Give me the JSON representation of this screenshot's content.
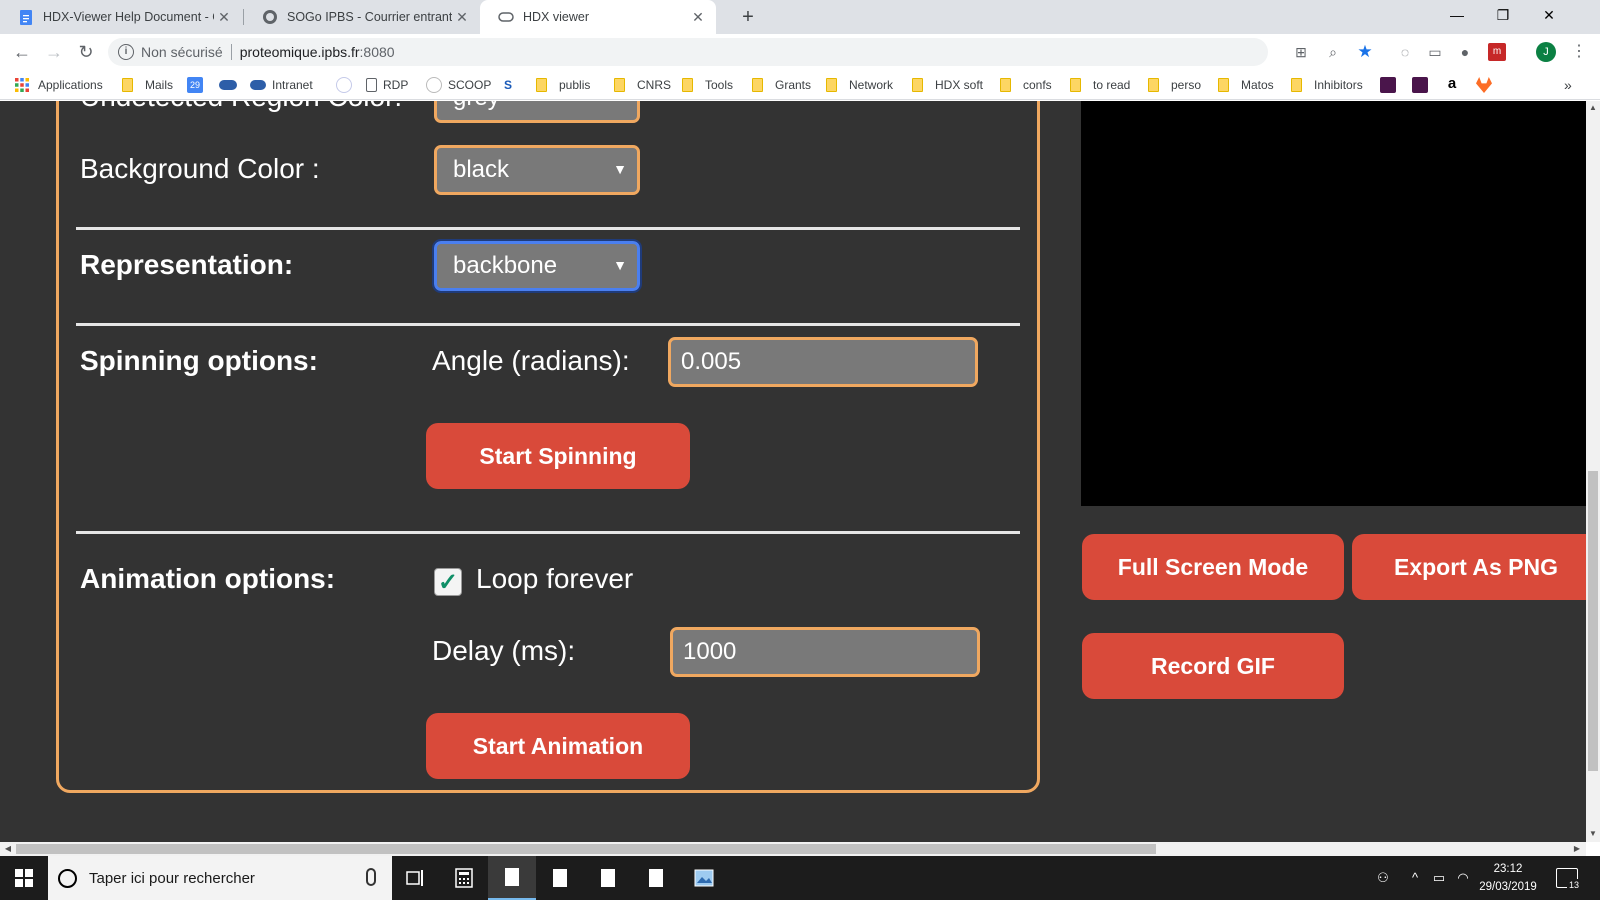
{
  "browser": {
    "tabs": [
      {
        "title": "HDX-Viewer Help Document - Go",
        "favicon": "docs-icon"
      },
      {
        "title": "SOGo IPBS - Courrier entrant",
        "favicon": "sogo-icon"
      },
      {
        "title": "HDX viewer",
        "favicon": "cloud-icon"
      }
    ],
    "window_controls": {
      "minimize": "—",
      "maximize": "❐",
      "close": "✕"
    },
    "security_label": "Non sécurisé",
    "url_host": "proteomique.ipbs.fr",
    "url_port": ":8080",
    "bookmarks": [
      "Applications",
      "Mails",
      "Intranet",
      "RDP",
      "SCOOP",
      "publis",
      "CNRS",
      "Tools",
      "Grants",
      "Network",
      "HDX soft",
      "confs",
      "to read",
      "perso",
      "Matos",
      "Inhibitors"
    ],
    "bookmark_calendar_day": "29",
    "profile_initial": "J",
    "overflow": "»"
  },
  "panel": {
    "undetected_label": "Undetected Region Color:",
    "undetected_value": "grey",
    "background_label": "Background Color :",
    "background_value": "black",
    "representation_label": "Representation:",
    "representation_value": "backbone",
    "spinning_label": "Spinning options:",
    "angle_label": "Angle (radians):",
    "angle_value": "0.005",
    "start_spinning": "Start Spinning",
    "animation_label": "Animation options:",
    "loop_label": "Loop forever",
    "loop_checked": true,
    "delay_label": "Delay (ms):",
    "delay_value": "1000",
    "start_animation": "Start Animation"
  },
  "viewer": {
    "full_screen": "Full Screen Mode",
    "export_png": "Export As PNG",
    "record_gif": "Record GIF"
  },
  "taskbar": {
    "search_placeholder": "Taper ici pour rechercher",
    "time": "23:12",
    "date": "29/03/2019",
    "notification_count": "13"
  },
  "colors": {
    "accent_orange": "#f0a860",
    "button_red": "#d94a3a",
    "page_bg": "#333333",
    "check_green": "#0f8f67"
  }
}
